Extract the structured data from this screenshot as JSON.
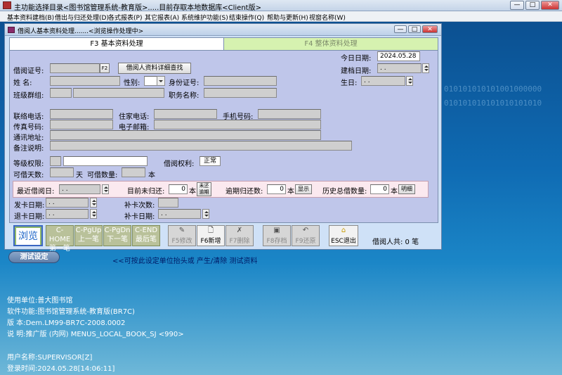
{
  "main_window": {
    "title": "主功能选择目录<图书馆管理系统-教育版>.....目前存取本地数据库<Client版>",
    "controls": {
      "minimize": "—",
      "maximize": "□",
      "close": "✕"
    }
  },
  "menu": [
    "基本资料建档(B)",
    "借出与归还处理(D)",
    "各式报表(P)",
    "其它报表(A)",
    "系统维护功能(S)",
    "结束操作(Q)",
    "帮助与更新(H)",
    "视窗名称(W)"
  ],
  "child_window": {
    "title": "借阅人基本资料处理.......<浏览操作处理中>",
    "tabs": [
      "F3 基本资料处理",
      "F4 整体资料处理"
    ]
  },
  "form": {
    "today_label": "今日日期:",
    "today_value": "2024.05.28",
    "card_label": "借阅证号:",
    "card_value": "",
    "card_f2": "F2",
    "search_button": "借阅人资料详细查找",
    "created_label": "建档日期:",
    "created_value": "  .  .  ",
    "name_label": "姓    名:",
    "gender_label": "性别:",
    "idcard_label": "身份证号:",
    "birthday_label": "生日:",
    "birthday_value": "  .  .  ",
    "class_label": "班级群组:",
    "position_label": "职务名称:",
    "contact_label": "联络电话:",
    "home_phone_label": "住家电话:",
    "mobile_label": "手机号码:",
    "fax_label": "传真号码:",
    "email_label": "电子邮箱:",
    "address_label": "通讯地址:",
    "notes_label": "备注说明:",
    "level_label": "等级权限:",
    "right_label": "借阅权利:",
    "right_value": "正常",
    "days_label": "可借天数:",
    "days_unit": "天",
    "quantity_label": "可借数量:",
    "quantity_unit": "本",
    "last_borrow_label": "最近借阅日:",
    "last_borrow_value": "  .  .  ",
    "unreturned_label": "目前未归还:",
    "unreturned_value": "0",
    "unreturned_unit": "本",
    "unreturned_btn_line1": "未还",
    "unreturned_btn_line2": "逾期",
    "overdue_label": "逾期归还数:",
    "overdue_value": "0",
    "overdue_unit": "本",
    "overdue_btn": "显示",
    "history_label": "历史总借数量:",
    "history_value": "0",
    "history_unit": "本",
    "history_btn": "明细",
    "issue_label": "发卡日期:",
    "issue_value": "  .  .  ",
    "reissue_count_label": "补卡次数:",
    "return_card_label": "退卡日期:",
    "return_card_value": "  .  .  ",
    "reissue_date_label": "补卡日期:",
    "reissue_date_value": "  .  .  "
  },
  "toolbar": {
    "browse": "浏览",
    "first": [
      "C-HOME",
      "第一笔"
    ],
    "prev": [
      "C-PgUp",
      "上一笔"
    ],
    "next": [
      "C-PgDn",
      "下一笔"
    ],
    "last": [
      "C-END",
      "最后笔"
    ],
    "modify": "F5修改",
    "add": "F6新增",
    "delete": "F7删除",
    "save": "F8存档",
    "restore": "F9还原",
    "exit": "ESC退出",
    "count_text": "借阅人共: 0 笔"
  },
  "desktop": {
    "test_button": "测试设定",
    "test_hint": "<<可按此设定单位抬头或 产生/清除 测试资料",
    "watermark": [
      "010101010101001000000",
      "010101010101010101010"
    ],
    "unit_label": "使用单位:",
    "unit_value": "普大图书馆",
    "function_label": "软件功能:",
    "function_value": "图书馆管理系统-教育版(BR7C)",
    "version_label": "版      本:",
    "version_value": "Dem.LM99-BR7C-2008.0002",
    "desc_label": "说      明:",
    "desc_value": "推广版 (内网) MENUS_LOCAL_BOOK_SJ <990>",
    "user_label": "用户名称:",
    "user_value": "SUPERVISOR[Z]",
    "login_label": "登录时间:",
    "login_value": "2024.05.28[14:06:11]"
  }
}
